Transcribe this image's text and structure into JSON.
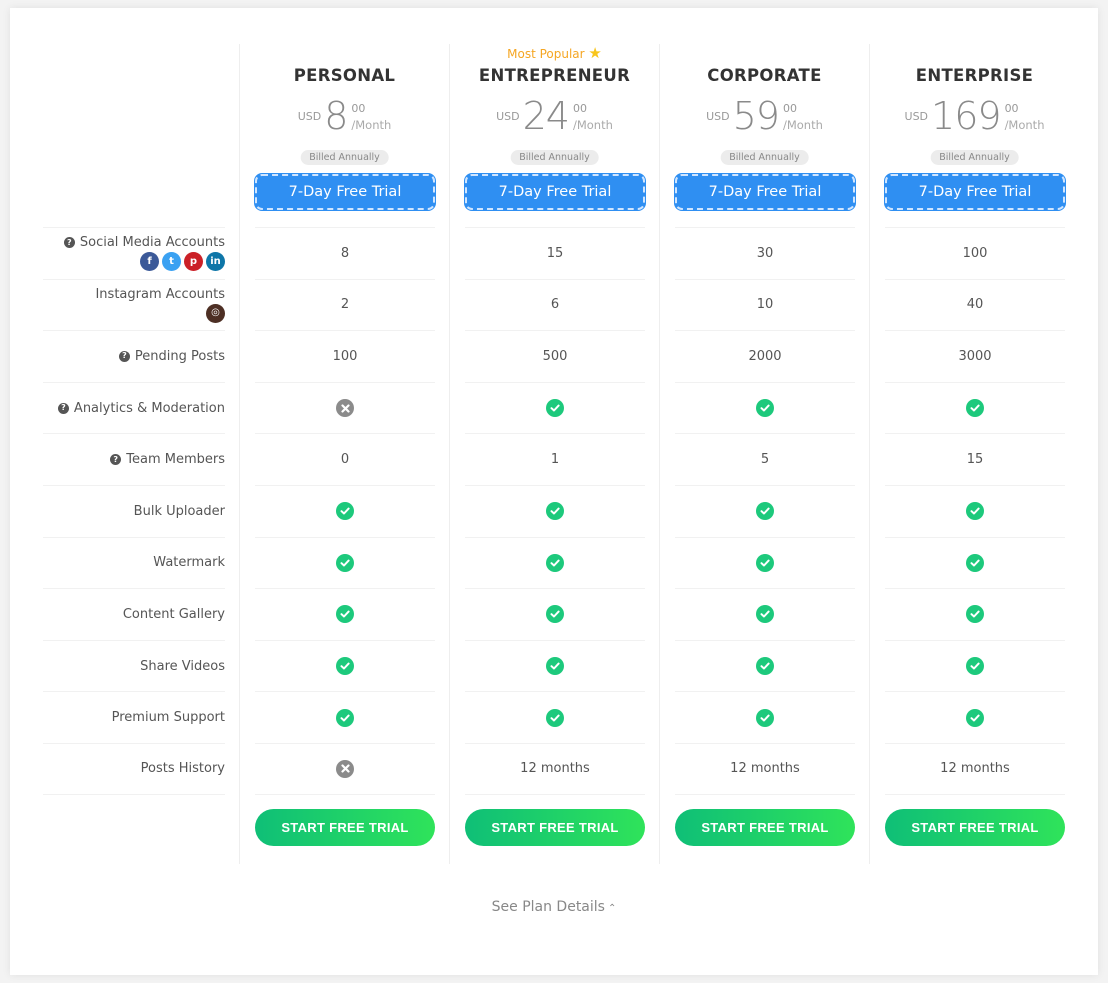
{
  "colors": {
    "trial_button": "#2f8ff2",
    "start_button_from": "#0fbf77",
    "start_button_to": "#2fe35a",
    "check": "#1dc97c",
    "cross": "#8b8b8b",
    "popular": "#f5a623"
  },
  "popular_badge": {
    "label": "Most Popular",
    "icon": "star-icon",
    "plan_index": 1
  },
  "features": [
    {
      "label": "Social Media Accounts",
      "help": true,
      "icons": [
        "facebook-icon",
        "twitter-icon",
        "pinterest-icon",
        "linkedin-icon"
      ]
    },
    {
      "label": "Instagram Accounts",
      "help": false,
      "icons": [
        "instagram-icon"
      ]
    },
    {
      "label": "Pending Posts",
      "help": true
    },
    {
      "label": "Analytics & Moderation",
      "help": true
    },
    {
      "label": "Team Members",
      "help": true
    },
    {
      "label": "Bulk Uploader",
      "help": false
    },
    {
      "label": "Watermark",
      "help": false
    },
    {
      "label": "Content Gallery",
      "help": false
    },
    {
      "label": "Share Videos",
      "help": false
    },
    {
      "label": "Premium Support",
      "help": false
    },
    {
      "label": "Posts History",
      "help": false
    }
  ],
  "plans": [
    {
      "name": "PERSONAL",
      "currency": "USD",
      "amount": "8",
      "cents": "00",
      "period": "/Month",
      "billing": "Billed Annually",
      "trial_label": "7-Day Free Trial",
      "cta_label": "START FREE TRIAL",
      "values": [
        "8",
        "2",
        "100",
        "cross",
        "0",
        "check",
        "check",
        "check",
        "check",
        "check",
        "cross"
      ]
    },
    {
      "name": "ENTREPRENEUR",
      "currency": "USD",
      "amount": "24",
      "cents": "00",
      "period": "/Month",
      "billing": "Billed Annually",
      "trial_label": "7-Day Free Trial",
      "cta_label": "START FREE TRIAL",
      "values": [
        "15",
        "6",
        "500",
        "check",
        "1",
        "check",
        "check",
        "check",
        "check",
        "check",
        "12 months"
      ]
    },
    {
      "name": "CORPORATE",
      "currency": "USD",
      "amount": "59",
      "cents": "00",
      "period": "/Month",
      "billing": "Billed Annually",
      "trial_label": "7-Day Free Trial",
      "cta_label": "START FREE TRIAL",
      "values": [
        "30",
        "10",
        "2000",
        "check",
        "5",
        "check",
        "check",
        "check",
        "check",
        "check",
        "12 months"
      ]
    },
    {
      "name": "ENTERPRISE",
      "currency": "USD",
      "amount": "169",
      "cents": "00",
      "period": "/Month",
      "billing": "Billed Annually",
      "trial_label": "7-Day Free Trial",
      "cta_label": "START FREE TRIAL",
      "values": [
        "100",
        "40",
        "3000",
        "check",
        "15",
        "check",
        "check",
        "check",
        "check",
        "check",
        "12 months"
      ]
    }
  ],
  "footer": {
    "details_label": "See Plan Details",
    "details_icon": "chevron-up-icon"
  }
}
